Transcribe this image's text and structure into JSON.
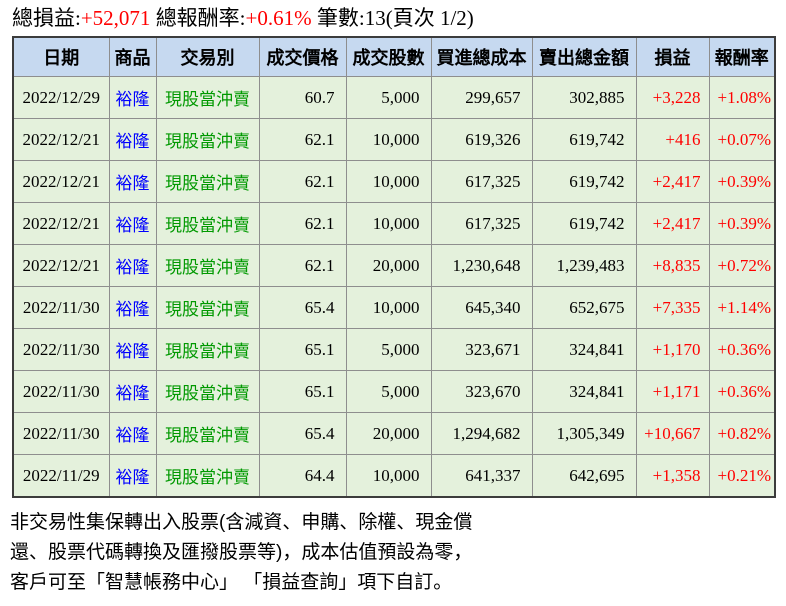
{
  "summary": {
    "pl_label": "總損益:",
    "pl_value": "+52,071",
    "return_label": " 總報酬率:",
    "return_value": "+0.61%",
    "count_text": " 筆數:13(頁次 1/2)"
  },
  "table": {
    "headers": [
      "日期",
      "商品",
      "交易別",
      "成交價格",
      "成交股數",
      "買進總成本",
      "賣出總金額",
      "損益",
      "報酬率"
    ],
    "rows": [
      {
        "date": "2022/12/29",
        "product": "裕隆",
        "type": "現股當沖賣",
        "price": "60.7",
        "shares": "5,000",
        "cost": "299,657",
        "amount": "302,885",
        "pl": "+3,228",
        "ret": "+1.08%"
      },
      {
        "date": "2022/12/21",
        "product": "裕隆",
        "type": "現股當沖賣",
        "price": "62.1",
        "shares": "10,000",
        "cost": "619,326",
        "amount": "619,742",
        "pl": "+416",
        "ret": "+0.07%"
      },
      {
        "date": "2022/12/21",
        "product": "裕隆",
        "type": "現股當沖賣",
        "price": "62.1",
        "shares": "10,000",
        "cost": "617,325",
        "amount": "619,742",
        "pl": "+2,417",
        "ret": "+0.39%"
      },
      {
        "date": "2022/12/21",
        "product": "裕隆",
        "type": "現股當沖賣",
        "price": "62.1",
        "shares": "10,000",
        "cost": "617,325",
        "amount": "619,742",
        "pl": "+2,417",
        "ret": "+0.39%"
      },
      {
        "date": "2022/12/21",
        "product": "裕隆",
        "type": "現股當沖賣",
        "price": "62.1",
        "shares": "20,000",
        "cost": "1,230,648",
        "amount": "1,239,483",
        "pl": "+8,835",
        "ret": "+0.72%"
      },
      {
        "date": "2022/11/30",
        "product": "裕隆",
        "type": "現股當沖賣",
        "price": "65.4",
        "shares": "10,000",
        "cost": "645,340",
        "amount": "652,675",
        "pl": "+7,335",
        "ret": "+1.14%"
      },
      {
        "date": "2022/11/30",
        "product": "裕隆",
        "type": "現股當沖賣",
        "price": "65.1",
        "shares": "5,000",
        "cost": "323,671",
        "amount": "324,841",
        "pl": "+1,170",
        "ret": "+0.36%"
      },
      {
        "date": "2022/11/30",
        "product": "裕隆",
        "type": "現股當沖賣",
        "price": "65.1",
        "shares": "5,000",
        "cost": "323,670",
        "amount": "324,841",
        "pl": "+1,171",
        "ret": "+0.36%"
      },
      {
        "date": "2022/11/30",
        "product": "裕隆",
        "type": "現股當沖賣",
        "price": "65.4",
        "shares": "20,000",
        "cost": "1,294,682",
        "amount": "1,305,349",
        "pl": "+10,667",
        "ret": "+0.82%"
      },
      {
        "date": "2022/11/29",
        "product": "裕隆",
        "type": "現股當沖賣",
        "price": "64.4",
        "shares": "10,000",
        "cost": "641,337",
        "amount": "642,695",
        "pl": "+1,358",
        "ret": "+0.21%"
      }
    ]
  },
  "footnote": {
    "line1": "非交易性集保轉出入股票(含減資、申購、除權、現金償",
    "line2": "還、股票代碼轉換及匯撥股票等)，成本估值預設為零，",
    "line3": "客戶可至「智慧帳務中心」 「損益查詢」項下自訂。"
  },
  "colors": {
    "positive_value": "#ff0000",
    "product_text": "#0000ff",
    "trade_type_text": "#009900",
    "header_bg": "#c6d9f0",
    "row_bg": "#e4f1dc",
    "grid_line": "#8e8e8e"
  }
}
